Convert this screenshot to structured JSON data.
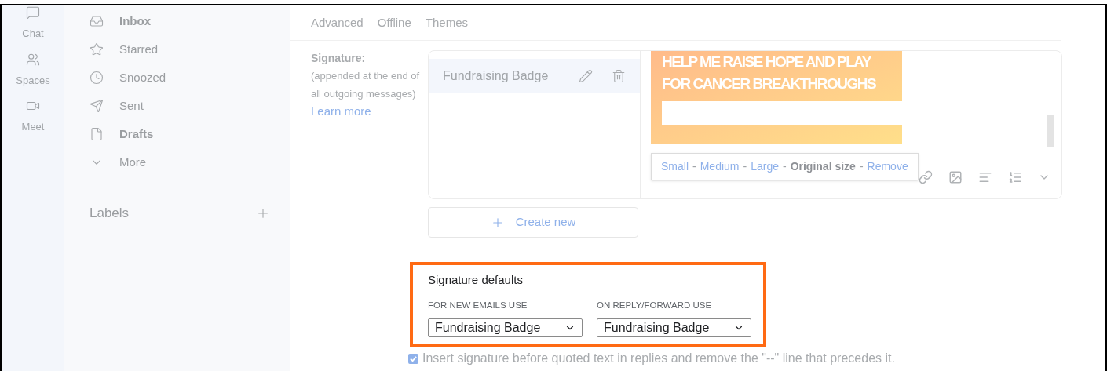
{
  "rail": [
    {
      "label": "Chat"
    },
    {
      "label": "Spaces"
    },
    {
      "label": "Meet"
    }
  ],
  "nav": [
    {
      "label": "Inbox",
      "bold": true
    },
    {
      "label": "Starred",
      "bold": false
    },
    {
      "label": "Snoozed",
      "bold": false
    },
    {
      "label": "Sent",
      "bold": false
    },
    {
      "label": "Drafts",
      "bold": true
    },
    {
      "label": "More",
      "bold": false
    }
  ],
  "labels_heading": "Labels",
  "tabs": [
    "Advanced",
    "Offline",
    "Themes"
  ],
  "signature": {
    "title": "Signature:",
    "note": "(appended at the end of all outgoing messages)",
    "link": "Learn more",
    "items": [
      {
        "name": "Fundraising Badge",
        "selected": true
      }
    ],
    "create_button": "Create new",
    "banner_lines": [
      "HELP ME RAISE HOPE AND PLAY",
      "FOR CANCER BREAKTHROUGHS"
    ],
    "size_menu": [
      {
        "label": "Small",
        "kind": "link"
      },
      {
        "label": "-",
        "kind": "separator"
      },
      {
        "label": "Medium",
        "kind": "link"
      },
      {
        "label": "-",
        "kind": "separator"
      },
      {
        "label": "Large",
        "kind": "link"
      },
      {
        "label": "-",
        "kind": "separator"
      },
      {
        "label": "Original size",
        "kind": "current"
      },
      {
        "label": "-",
        "kind": "separator"
      },
      {
        "label": "Remove",
        "kind": "link"
      }
    ]
  },
  "defaults": {
    "title": "Signature defaults",
    "selects": [
      {
        "label": "FOR NEW EMAILS USE",
        "value": "Fundraising Badge"
      },
      {
        "label": "ON REPLY/FORWARD USE",
        "value": "Fundraising Badge"
      }
    ]
  },
  "insert_option": {
    "label": "Insert signature before quoted text in replies and remove the \"--\" line that precedes it.",
    "checked": true
  }
}
